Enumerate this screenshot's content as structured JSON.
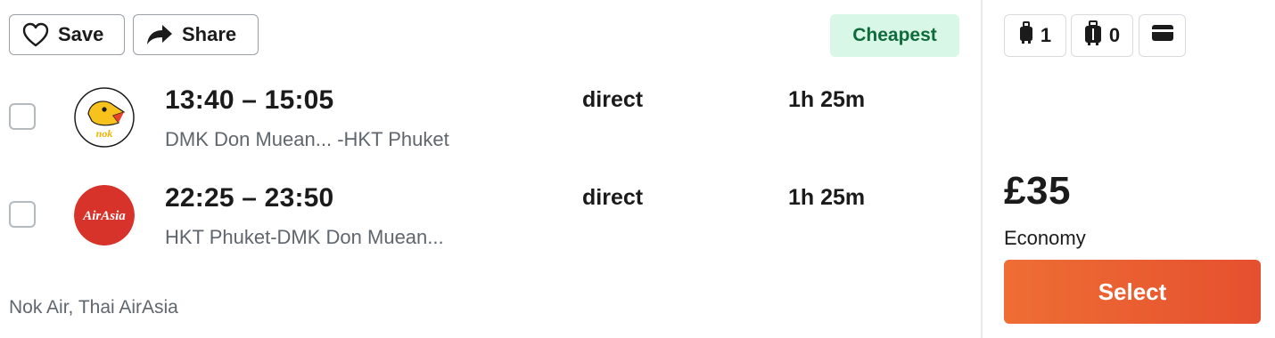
{
  "actions": {
    "save_label": "Save",
    "share_label": "Share"
  },
  "badge": {
    "label": "Cheapest"
  },
  "flights": [
    {
      "times": "13:40 – 15:05",
      "route": "DMK Don Muean... -HKT Phuket",
      "stops": "direct",
      "duration": "1h 25m",
      "airline_logo": "nok-air-logo",
      "logo_text": "nok"
    },
    {
      "times": "22:25 – 23:50",
      "route": "HKT Phuket-DMK Don Muean...",
      "stops": "direct",
      "duration": "1h 25m",
      "airline_logo": "airasia-logo",
      "logo_text": "AirAsia"
    }
  ],
  "airlines_text": "Nok Air, Thai AirAsia",
  "baggage": {
    "cabin_bag_count": "1",
    "checked_bag_count": "0",
    "payment_icon": "card-icon"
  },
  "fare": {
    "price": "£35",
    "cabin": "Economy",
    "select_label": "Select"
  },
  "colors": {
    "accent": "#e5502f",
    "badge_bg": "#d8f7e6",
    "badge_text": "#0f6b3c",
    "airasia_red": "#d8332b"
  }
}
